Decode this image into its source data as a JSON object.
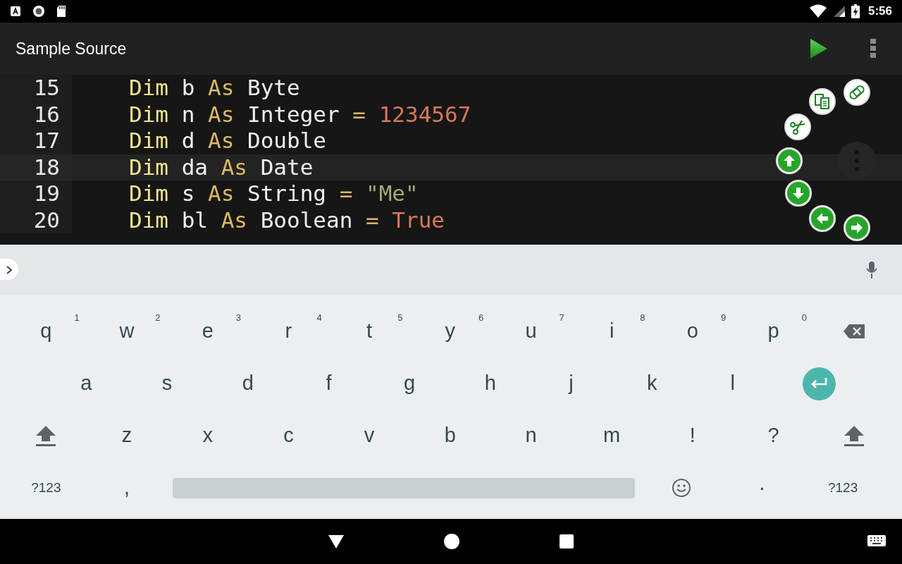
{
  "status_bar": {
    "time": "5:56"
  },
  "toolbar": {
    "title": "Sample Source"
  },
  "editor": {
    "lines": [
      {
        "number": "15",
        "current": false,
        "tokens": [
          {
            "kind": "keyword",
            "text": "Dim"
          },
          {
            "kind": "plain",
            "text": " b "
          },
          {
            "kind": "as",
            "text": "As"
          },
          {
            "kind": "plain",
            "text": " Byte"
          }
        ]
      },
      {
        "number": "16",
        "current": false,
        "tokens": [
          {
            "kind": "keyword",
            "text": "Dim"
          },
          {
            "kind": "plain",
            "text": " n "
          },
          {
            "kind": "as",
            "text": "As"
          },
          {
            "kind": "plain",
            "text": " Integer "
          },
          {
            "kind": "as",
            "text": "="
          },
          {
            "kind": "number",
            "text": " 1234567"
          }
        ]
      },
      {
        "number": "17",
        "current": false,
        "tokens": [
          {
            "kind": "keyword",
            "text": "Dim"
          },
          {
            "kind": "plain",
            "text": " d "
          },
          {
            "kind": "as",
            "text": "As"
          },
          {
            "kind": "plain",
            "text": " Double"
          }
        ]
      },
      {
        "number": "18",
        "current": true,
        "tokens": [
          {
            "kind": "keyword",
            "text": "Dim"
          },
          {
            "kind": "plain",
            "text": " da "
          },
          {
            "kind": "as",
            "text": "As"
          },
          {
            "kind": "plain",
            "text": " Date"
          }
        ]
      },
      {
        "number": "19",
        "current": false,
        "tokens": [
          {
            "kind": "keyword",
            "text": "Dim"
          },
          {
            "kind": "plain",
            "text": " s "
          },
          {
            "kind": "as",
            "text": "As"
          },
          {
            "kind": "plain",
            "text": " String "
          },
          {
            "kind": "as",
            "text": "="
          },
          {
            "kind": "string",
            "text": " \"Me\""
          }
        ]
      },
      {
        "number": "20",
        "current": false,
        "tokens": [
          {
            "kind": "keyword",
            "text": "Dim"
          },
          {
            "kind": "plain",
            "text": " bl "
          },
          {
            "kind": "as",
            "text": "As"
          },
          {
            "kind": "plain",
            "text": " Boolean "
          },
          {
            "kind": "as",
            "text": "="
          },
          {
            "kind": "number",
            "text": " True"
          }
        ]
      }
    ]
  },
  "keyboard": {
    "rows": [
      {
        "keys": [
          {
            "kind": "char",
            "label": "q",
            "hint": "1"
          },
          {
            "kind": "char",
            "label": "w",
            "hint": "2"
          },
          {
            "kind": "char",
            "label": "e",
            "hint": "3"
          },
          {
            "kind": "char",
            "label": "r",
            "hint": "4"
          },
          {
            "kind": "char",
            "label": "t",
            "hint": "5"
          },
          {
            "kind": "char",
            "label": "y",
            "hint": "6"
          },
          {
            "kind": "char",
            "label": "u",
            "hint": "7"
          },
          {
            "kind": "char",
            "label": "i",
            "hint": "8"
          },
          {
            "kind": "char",
            "label": "o",
            "hint": "9"
          },
          {
            "kind": "char",
            "label": "p",
            "hint": "0"
          },
          {
            "kind": "backspace"
          }
        ]
      },
      {
        "keys": [
          {
            "kind": "char",
            "label": "a"
          },
          {
            "kind": "char",
            "label": "s"
          },
          {
            "kind": "char",
            "label": "d"
          },
          {
            "kind": "char",
            "label": "f"
          },
          {
            "kind": "char",
            "label": "g"
          },
          {
            "kind": "char",
            "label": "h"
          },
          {
            "kind": "char",
            "label": "j"
          },
          {
            "kind": "char",
            "label": "k"
          },
          {
            "kind": "char",
            "label": "l"
          },
          {
            "kind": "enter"
          }
        ]
      },
      {
        "keys": [
          {
            "kind": "shift"
          },
          {
            "kind": "char",
            "label": "z"
          },
          {
            "kind": "char",
            "label": "x"
          },
          {
            "kind": "char",
            "label": "c"
          },
          {
            "kind": "char",
            "label": "v"
          },
          {
            "kind": "char",
            "label": "b"
          },
          {
            "kind": "char",
            "label": "n"
          },
          {
            "kind": "char",
            "label": "m"
          },
          {
            "kind": "char",
            "label": "!"
          },
          {
            "kind": "char",
            "label": "?"
          },
          {
            "kind": "shift"
          }
        ]
      },
      {
        "keys": [
          {
            "kind": "symbols",
            "label": "?123"
          },
          {
            "kind": "char",
            "label": ","
          },
          {
            "kind": "space"
          },
          {
            "kind": "emoji"
          },
          {
            "kind": "char",
            "label": "·"
          },
          {
            "kind": "symbols",
            "label": "?123"
          }
        ]
      }
    ]
  }
}
